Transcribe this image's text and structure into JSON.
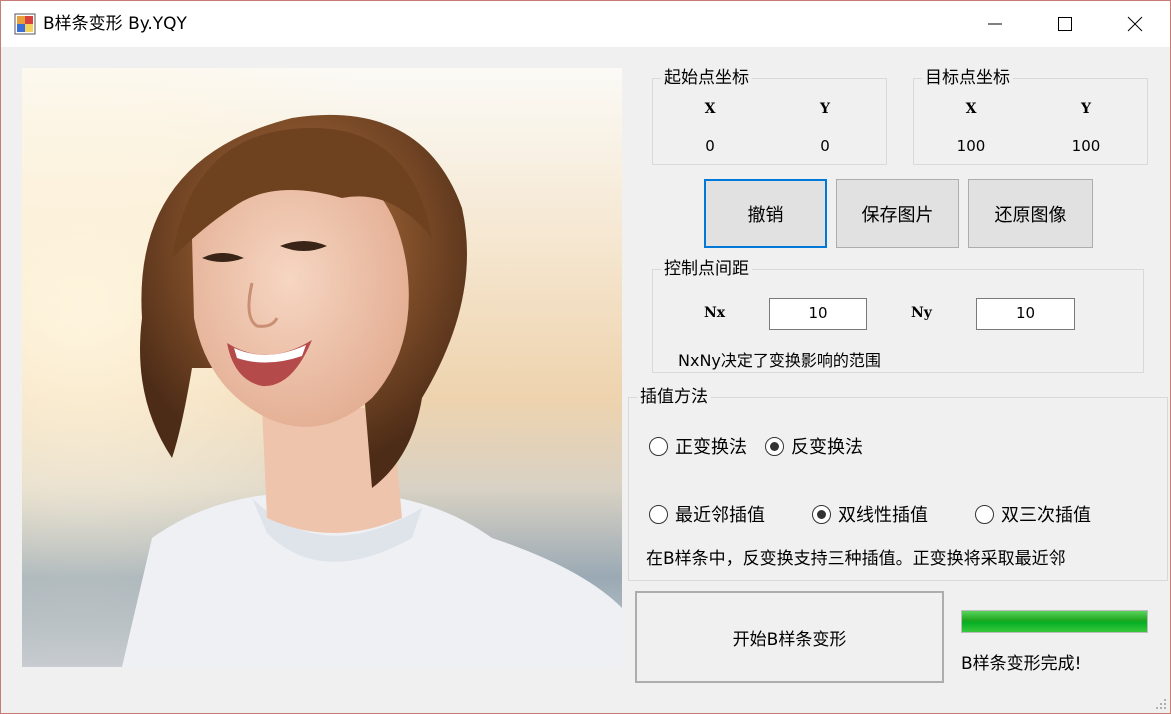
{
  "window": {
    "title": "B样条变形 By.YQY"
  },
  "start_point": {
    "title": "起始点坐标",
    "x_label": "X",
    "y_label": "Y",
    "x_value": "0",
    "y_value": "0"
  },
  "target_point": {
    "title": "目标点坐标",
    "x_label": "X",
    "y_label": "Y",
    "x_value": "100",
    "y_value": "100"
  },
  "buttons": {
    "undo": "撤销",
    "save": "保存图片",
    "restore": "还原图像",
    "start": "开始B样条变形"
  },
  "control_spacing": {
    "title": "控制点间距",
    "nx_label": "Nx",
    "ny_label": "Ny",
    "nx_value": "10",
    "ny_value": "10",
    "note": "NxNy决定了变换影响的范围"
  },
  "interpolation": {
    "title": "插值方法",
    "transform_options": [
      {
        "label": "正变换法",
        "checked": false
      },
      {
        "label": "反变换法",
        "checked": true
      }
    ],
    "interp_options": [
      {
        "label": "最近邻插值",
        "checked": false
      },
      {
        "label": "双线性插值",
        "checked": true
      },
      {
        "label": "双三次插值",
        "checked": false
      }
    ],
    "note": "在B样条中，反变换支持三种插值。正变换将采取最近邻"
  },
  "progress": {
    "percent": 100,
    "status": "B样条变形完成!"
  }
}
